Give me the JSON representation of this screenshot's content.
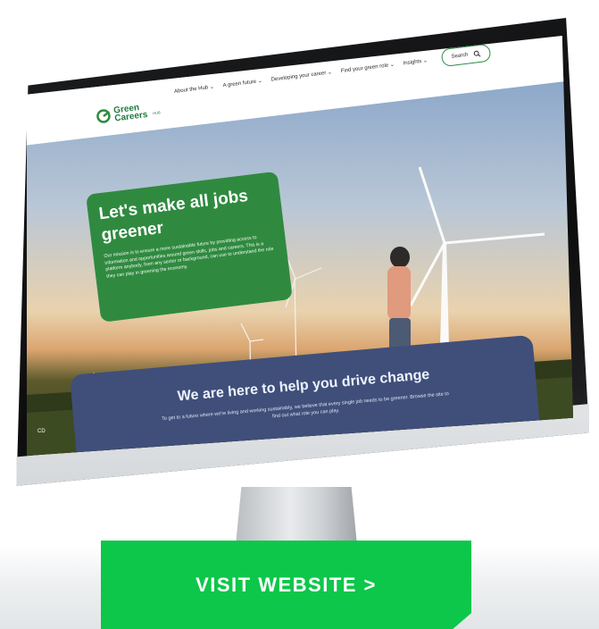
{
  "site": {
    "logo": {
      "line1": "Green",
      "line2": "Careers",
      "suffix": "HUB"
    },
    "nav": {
      "items": [
        {
          "label": "About the Hub ⌄"
        },
        {
          "label": "A green future ⌄"
        },
        {
          "label": "Developing your career ⌄"
        },
        {
          "label": "Find your green role ⌄"
        },
        {
          "label": "Insights ⌄"
        }
      ],
      "search_label": "Search"
    },
    "hero": {
      "title": "Let's make all jobs greener",
      "body": "Our mission is to ensure a more sustainable future by providing access to information and opportunities around green skills, jobs and careers. This is a platform anybody, from any sector or background, can use to understand the role they can play in greening the economy."
    },
    "section": {
      "title": "We are here to help you drive change",
      "body": "To get to a future where we're living and working sustainably, we believe that every single job needs to be greener. Browse the site to find out what role you can play."
    },
    "badge": "CD"
  },
  "cta": {
    "label": "VISIT WEBSITE >"
  },
  "colors": {
    "brand_green": "#2f8a3f",
    "cta_green": "#0dc74a",
    "section_blue": "#3f4f7a"
  }
}
